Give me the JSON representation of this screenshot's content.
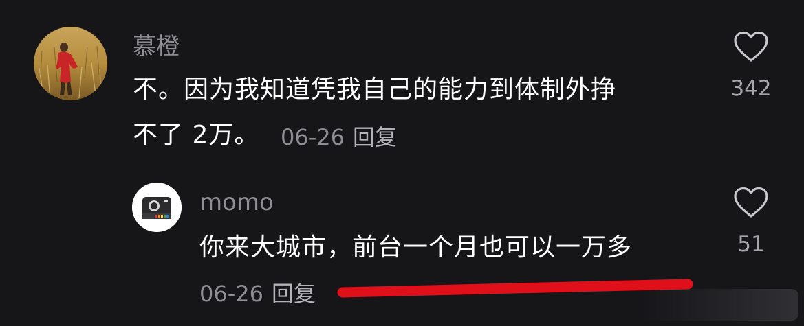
{
  "comment": {
    "username": "慕橙",
    "text_line1": "不。因为我知道凭我自己的能力到体制外挣",
    "text_line2": "不了 2万。",
    "date": "06-26",
    "reply_label": "回复",
    "like_count": "342",
    "avatar_icon": "profile-photo-person-in-field-icon"
  },
  "reply": {
    "username": "momo",
    "text": "你来大城市，前台一个月也可以一万多",
    "date": "06-26",
    "reply_label": "回复",
    "like_count": "51",
    "avatar_icon": "camera-profile-icon"
  },
  "colors": {
    "background": "#161619",
    "secondary_text": "#8e8e93",
    "annotation_red": "#e0101a"
  }
}
